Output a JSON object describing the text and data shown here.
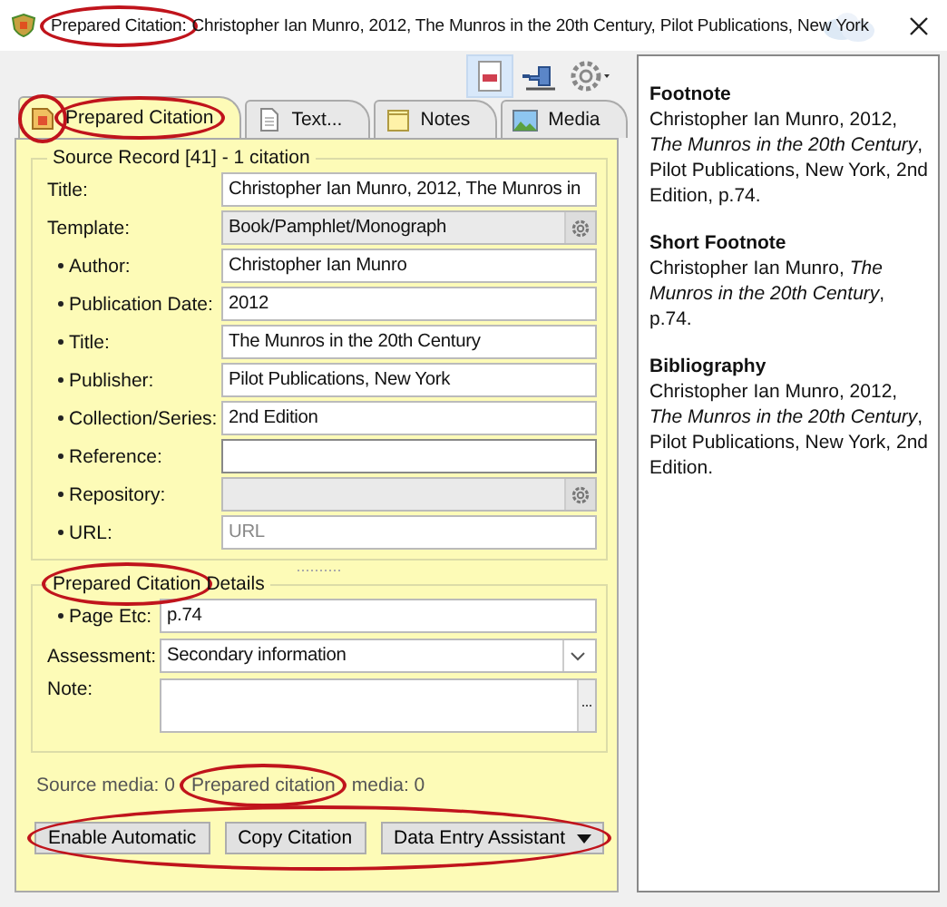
{
  "window": {
    "title_parts": [
      {
        "text": "Prepared Citation:",
        "annotated": true
      },
      {
        "text": "Christopher Ian Munro, 2012, The Munros in the 20th Century, Pilot Publications, New York",
        "annotated": false
      }
    ]
  },
  "tabs": [
    {
      "label": "Prepared Citation",
      "selected": true,
      "annotated": true
    },
    {
      "label": "Text...",
      "selected": false,
      "annotated": false
    },
    {
      "label": "Notes",
      "selected": false,
      "annotated": false
    },
    {
      "label": "Media",
      "selected": false,
      "annotated": false
    }
  ],
  "source_record": {
    "legend": "Source Record [41] - 1 citation",
    "fields": [
      {
        "label": "Title:",
        "bullet": false,
        "kind": "text",
        "value": "Christopher Ian Munro, 2012, The Munros in"
      },
      {
        "label": "Template:",
        "bullet": false,
        "kind": "template",
        "value": "Book/Pamphlet/Monograph"
      },
      {
        "label": "Author:",
        "bullet": true,
        "kind": "text",
        "value": "Christopher Ian Munro"
      },
      {
        "label": "Publication Date:",
        "bullet": true,
        "kind": "text",
        "value": "2012"
      },
      {
        "label": "Title:",
        "bullet": true,
        "kind": "text",
        "value": "The Munros in the 20th Century"
      },
      {
        "label": "Publisher:",
        "bullet": true,
        "kind": "text",
        "value": "Pilot Publications, New York"
      },
      {
        "label": "Collection/Series:",
        "bullet": true,
        "kind": "text",
        "value": "2nd Edition"
      },
      {
        "label": "Reference:",
        "bullet": true,
        "kind": "text",
        "focused": true
      },
      {
        "label": "Repository:",
        "bullet": true,
        "kind": "template"
      },
      {
        "label": "URL:",
        "bullet": true,
        "kind": "text",
        "placeholder": "URL"
      }
    ]
  },
  "details": {
    "legend_parts": [
      {
        "text": "Prepared Citation",
        "annotated": true
      },
      {
        "text": "Details",
        "annotated": false
      }
    ],
    "fields": [
      {
        "label": "Page Etc:",
        "bullet": true,
        "kind": "text",
        "value": "p.74"
      },
      {
        "label": "Assessment:",
        "bullet": false,
        "kind": "dropdown",
        "value": "Secondary information"
      },
      {
        "label": "Note:",
        "bullet": false,
        "kind": "memo"
      }
    ]
  },
  "status_parts": [
    {
      "text": "Source media: 0",
      "annotated": false
    },
    {
      "text": "Prepared citation",
      "annotated": true
    },
    {
      "text": "media: 0",
      "annotated": false
    }
  ],
  "buttons_annotated": true,
  "buttons": [
    {
      "label": "Enable Automatic",
      "kind": "button"
    },
    {
      "label": "Copy Citation",
      "kind": "button"
    },
    {
      "label": "Data Entry Assistant",
      "kind": "dropdown"
    }
  ],
  "citations": [
    {
      "heading": "Footnote",
      "text": "Christopher Ian Munro, 2012, *The Munros in the 20th Century*, Pilot Publications, New York, 2nd Edition, p.74."
    },
    {
      "heading": "Short Footnote",
      "text": "Christopher Ian Munro, *The Munros in the 20th Century*, p.74."
    },
    {
      "heading": "Bibliography",
      "text": "Christopher Ian Munro, 2012, *The Munros in the 20th Century*, Pilot Publications, New York, 2nd Edition."
    }
  ]
}
